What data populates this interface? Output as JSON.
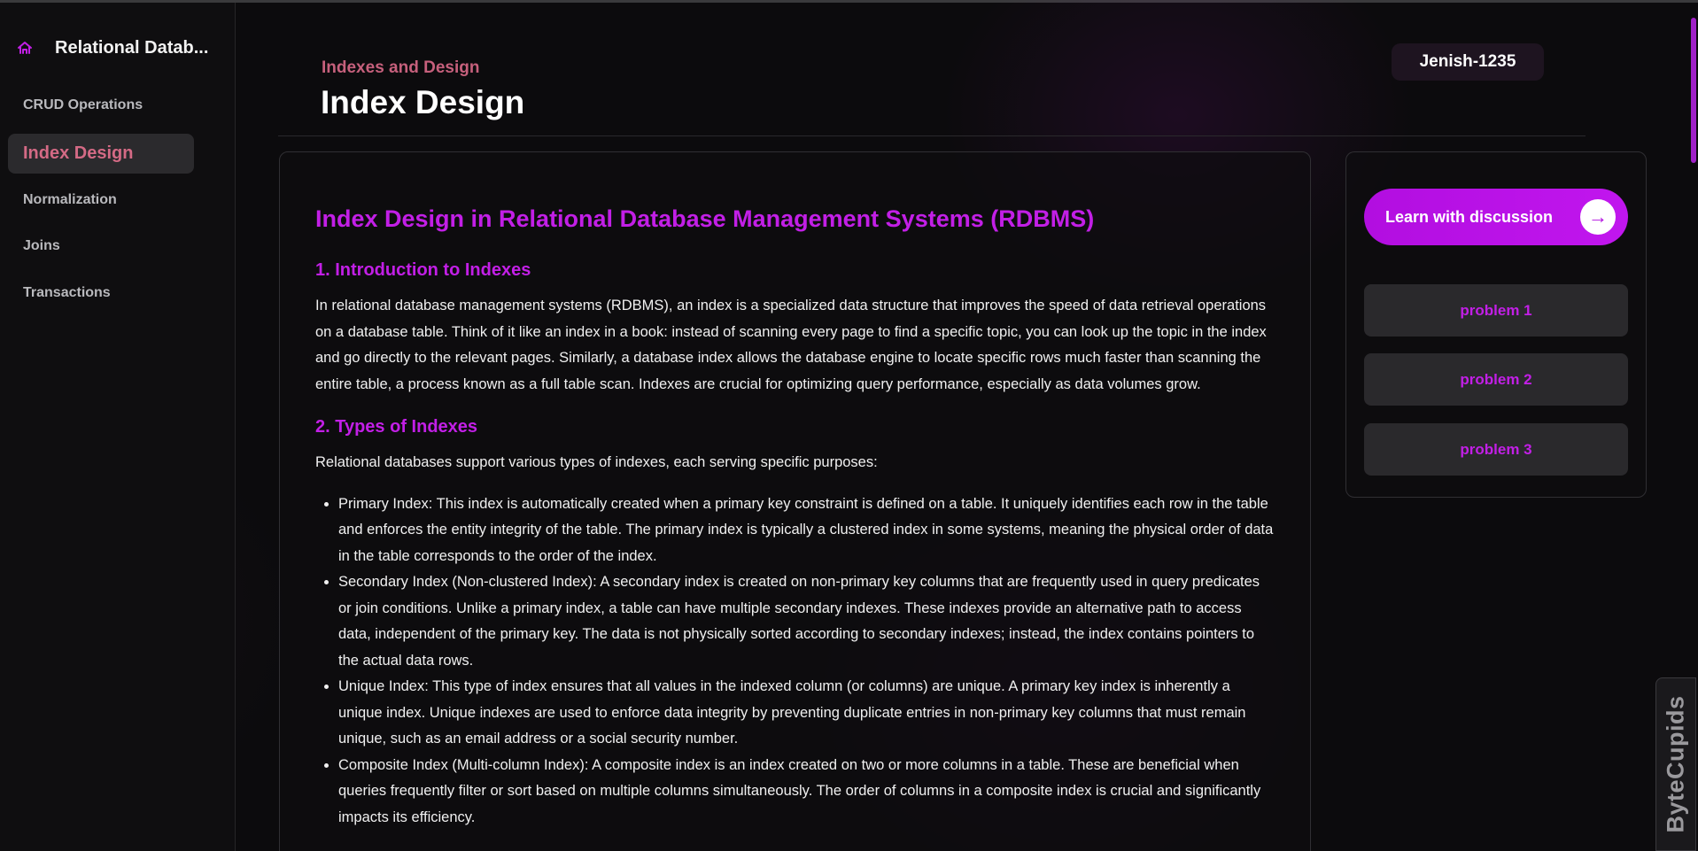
{
  "sidebar": {
    "app_title": "Relational Datab...",
    "items": [
      {
        "label": "CRUD Operations"
      },
      {
        "label": "Index Design"
      },
      {
        "label": "Normalization"
      },
      {
        "label": "Joins"
      },
      {
        "label": "Transactions"
      }
    ],
    "active_item": "Index Design"
  },
  "header": {
    "breadcrumb": "Indexes and Design",
    "title": "Index Design",
    "user": "Jenish-1235"
  },
  "article": {
    "title": "Index Design in Relational Database Management Systems (RDBMS)",
    "section1_heading": "1. Introduction to Indexes",
    "section1_body": "In relational database management systems (RDBMS), an index is a specialized data structure that improves the speed of data retrieval operations on a database table. Think of it like an index in a book: instead of scanning every page to find a specific topic, you can look up the topic in the index and go directly to the relevant pages. Similarly, a database index allows the database engine to locate specific rows much faster than scanning the entire table, a process known as a full table scan. Indexes are crucial for optimizing query performance, especially as data volumes grow.",
    "section2_heading": "2. Types of Indexes",
    "section2_intro": "Relational databases support various types of indexes, each serving specific purposes:",
    "section2_items": [
      "Primary Index: This index is automatically created when a primary key constraint is defined on a table. It uniquely identifies each row in the table and enforces the entity integrity of the table. The primary index is typically a clustered index in some systems, meaning the physical order of data in the table corresponds to the order of the index.",
      "Secondary Index (Non-clustered Index): A secondary index is created on non-primary key columns that are frequently used in query predicates or join conditions. Unlike a primary index, a table can have multiple secondary indexes. These indexes provide an alternative path to access data, independent of the primary key. The data is not physically sorted according to secondary indexes; instead, the index contains pointers to the actual data rows.",
      "Unique Index: This type of index ensures that all values in the indexed column (or columns) are unique. A primary key index is inherently a unique index. Unique indexes are used to enforce data integrity by preventing duplicate entries in non-primary key columns that must remain unique, such as an email address or a social security number.",
      "Composite Index (Multi-column Index): A composite index is an index created on two or more columns in a table. These are beneficial when queries frequently filter or sort based on multiple columns simultaneously. The order of columns in a composite index is crucial and significantly impacts its efficiency."
    ]
  },
  "side_panel": {
    "learn_button": "Learn with discussion",
    "learn_arrow": "→",
    "problems": [
      "problem 1",
      "problem 2",
      "problem 3"
    ]
  },
  "floating_tab": {
    "label": "ByteCupids"
  },
  "colors": {
    "accent": "#c21fe6",
    "breadcrumb": "#c6607c",
    "background": "#0c0b0d"
  }
}
